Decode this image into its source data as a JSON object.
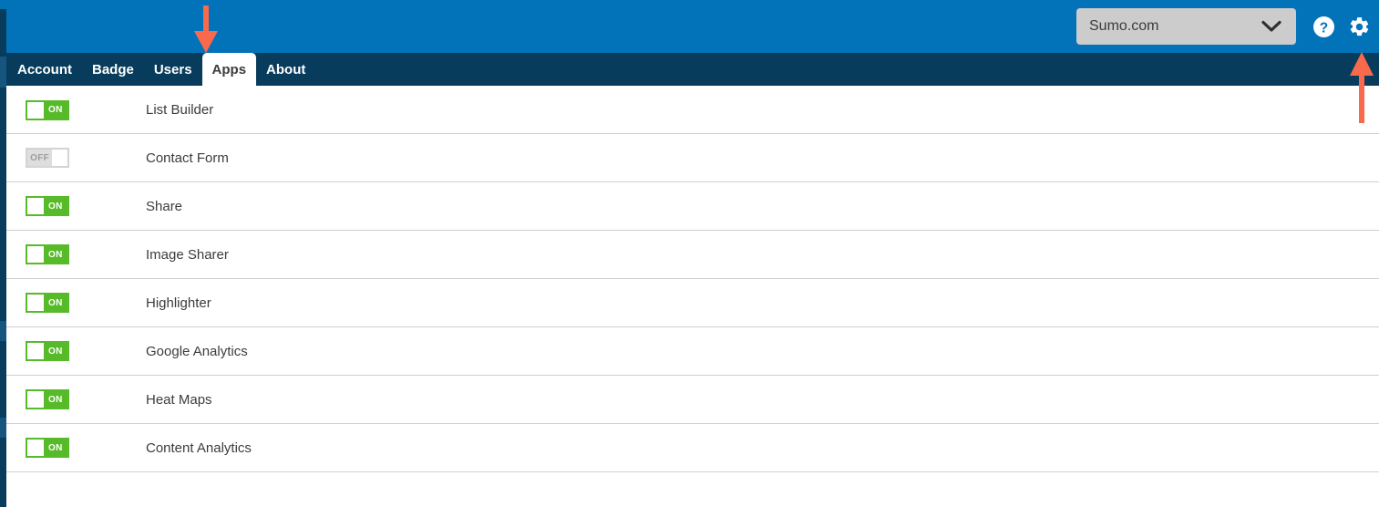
{
  "header": {
    "site_selector": {
      "value": "Sumo.com",
      "chevron_icon": "chevron-down-icon"
    },
    "help_icon": "help-circle-icon",
    "settings_icon": "gear-icon",
    "background_color": "#0273b8"
  },
  "nav": {
    "background_color": "#083c5c",
    "active_tab": "Apps",
    "tabs": [
      {
        "label": "Account",
        "active": false
      },
      {
        "label": "Badge",
        "active": false
      },
      {
        "label": "Users",
        "active": false
      },
      {
        "label": "Apps",
        "active": true
      },
      {
        "label": "About",
        "active": false
      }
    ]
  },
  "annotations": {
    "arrow_color": "#f96a4d",
    "arrow_down_target": "Apps",
    "arrow_up_target": "gear-icon"
  },
  "apps": {
    "toggle_on_label": "ON",
    "toggle_off_label": "OFF",
    "on_color": "#57bb29",
    "off_color": "#dedede",
    "rows": [
      {
        "name": "List Builder",
        "state": "on",
        "state_label": "ON"
      },
      {
        "name": "Contact Form",
        "state": "off",
        "state_label": "OFF"
      },
      {
        "name": "Share",
        "state": "on",
        "state_label": "ON"
      },
      {
        "name": "Image Sharer",
        "state": "on",
        "state_label": "ON"
      },
      {
        "name": "Highlighter",
        "state": "on",
        "state_label": "ON"
      },
      {
        "name": "Google Analytics",
        "state": "on",
        "state_label": "ON"
      },
      {
        "name": "Heat Maps",
        "state": "on",
        "state_label": "ON"
      },
      {
        "name": "Content Analytics",
        "state": "on",
        "state_label": "ON"
      }
    ]
  }
}
